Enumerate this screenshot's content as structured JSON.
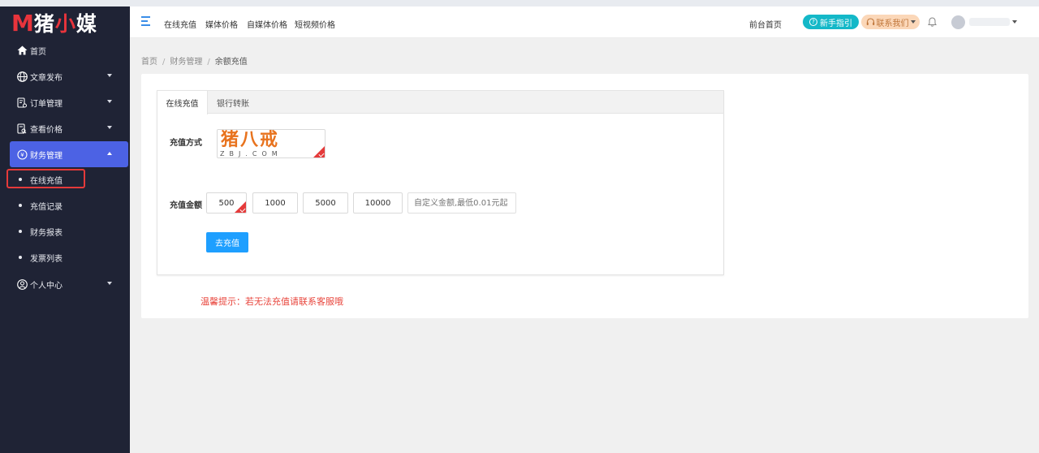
{
  "logo": {
    "mark": "M",
    "name_white": "猪",
    "name_red": "小",
    "name_white2": "媒"
  },
  "sidebar": {
    "items": [
      {
        "label": "首页",
        "icon": "home-icon"
      },
      {
        "label": "文章发布",
        "icon": "globe-icon"
      },
      {
        "label": "订单管理",
        "icon": "order-icon"
      },
      {
        "label": "查看价格",
        "icon": "price-icon"
      },
      {
        "label": "财务管理",
        "icon": "finance-icon"
      },
      {
        "label": "个人中心",
        "icon": "user-icon"
      }
    ],
    "sub_items": [
      {
        "label": "在线充值"
      },
      {
        "label": "充值记录"
      },
      {
        "label": "财务报表"
      },
      {
        "label": "发票列表"
      }
    ]
  },
  "topbar": {
    "links": [
      "在线充值",
      "媒体价格",
      "自媒体价格",
      "短视频价格"
    ],
    "front_home": "前台首页",
    "guide": "新手指引",
    "contact": "联系我们"
  },
  "breadcrumb": {
    "home": "首页",
    "level1": "财务管理",
    "current": "余额充值"
  },
  "tabs": {
    "online": "在线充值",
    "bank": "银行转账"
  },
  "form": {
    "method_label": "充值方式",
    "payment_brand": "猪八戒",
    "payment_domain": "ZBJ.COM",
    "amount_label": "充值金额",
    "amounts": [
      "500",
      "1000",
      "5000",
      "10000"
    ],
    "custom_placeholder": "自定义金额,最低0.01元起",
    "submit": "去充值"
  },
  "tip": "温馨提示：若无法充值请联系客服哦",
  "colors": {
    "sidebar_bg": "#1f2335",
    "active_bg": "#4c62e4",
    "primary": "#1e9fff",
    "tip": "#e8453c",
    "guide": "#14b8c8"
  }
}
